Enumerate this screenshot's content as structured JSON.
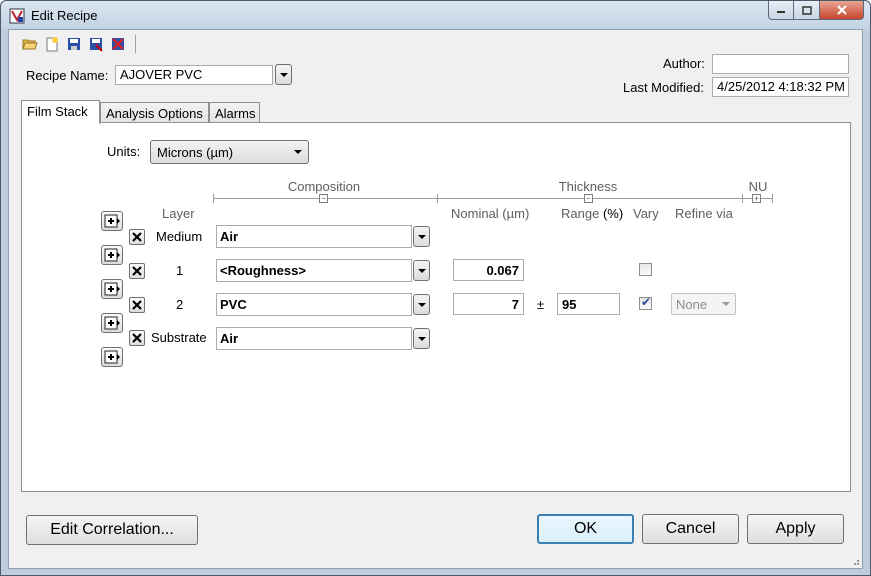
{
  "window": {
    "title": "Edit Recipe"
  },
  "toolbar": {
    "icons": [
      "open-folder-icon",
      "new-file-icon",
      "save-icon",
      "save-as-icon",
      "delete-file-icon"
    ]
  },
  "recipe": {
    "name_label": "Recipe Name:",
    "name_value": "AJOVER PVC"
  },
  "meta": {
    "author_label": "Author:",
    "author_value": "",
    "modified_label": "Last Modified:",
    "modified_value": "4/25/2012 4:18:32 PM"
  },
  "tabs": [
    "Film Stack",
    "Analysis Options",
    "Alarms"
  ],
  "units": {
    "label": "Units:",
    "value": "Microns (µm)"
  },
  "headers": {
    "composition": "Composition",
    "thickness": "Thickness",
    "nu": "NU",
    "layer": "Layer",
    "nominal": "Nominal (µm)",
    "range": "Range",
    "range_unit": "(%)",
    "vary": "Vary",
    "refine": "Refine via"
  },
  "layers": [
    {
      "name": "Medium",
      "composition": "Air"
    },
    {
      "name": "1",
      "composition": "<Roughness>",
      "nominal": "0.067",
      "vary": false
    },
    {
      "name": "2",
      "composition": "PVC",
      "nominal": "7",
      "pm": "±",
      "range": "95",
      "vary": true,
      "refine": "None"
    },
    {
      "name": "Substrate",
      "composition": "Air"
    }
  ],
  "buttons": {
    "edit_correlation": "Edit Correlation...",
    "ok": "OK",
    "cancel": "Cancel",
    "apply": "Apply"
  },
  "colors": {
    "titlebar": "#c3d3e3",
    "close": "#c7452d",
    "default_button": "#3c7fb1"
  }
}
